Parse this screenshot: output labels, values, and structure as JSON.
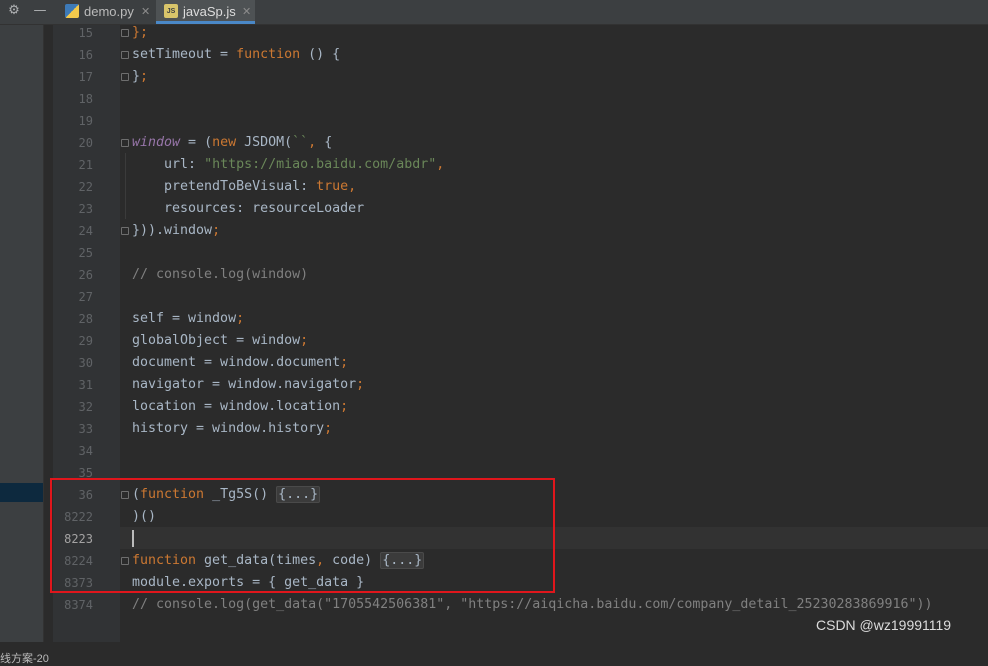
{
  "tabs": [
    {
      "label": "demo.py",
      "icon": "python-file-icon",
      "active": false
    },
    {
      "label": "javaSp.js",
      "icon": "js-file-icon",
      "active": true
    }
  ],
  "sidebar": {
    "cut_text": "线方案-20"
  },
  "current_line": "8223",
  "lines": [
    {
      "num": "15",
      "html": "<span class=\"kw\">}</span><span class=\"kw\">;</span>"
    },
    {
      "num": "16",
      "html": "setTimeout = <span class=\"kw\">function</span> () {"
    },
    {
      "num": "17",
      "html": "}<span class=\"kw\">;</span>"
    },
    {
      "num": "18",
      "html": ""
    },
    {
      "num": "19",
      "html": ""
    },
    {
      "num": "20",
      "html": "<span class=\"glob\">window</span> = (<span class=\"kw\">new</span> JSDOM(<span class=\"str\">``</span><span class=\"kw\">,</span> {"
    },
    {
      "num": "21",
      "html": "    url: <span class=\"str\">\"https://miao.baidu.com/abdr\"</span><span class=\"kw\">,</span>"
    },
    {
      "num": "22",
      "html": "    pretendToBeVisual: <span class=\"kw\">true,</span>"
    },
    {
      "num": "23",
      "html": "    resources: resourceLoader"
    },
    {
      "num": "24",
      "html": "})).window<span class=\"kw\">;</span>"
    },
    {
      "num": "25",
      "html": ""
    },
    {
      "num": "26",
      "html": "<span class=\"cmt\">// console.log(window)</span>"
    },
    {
      "num": "27",
      "html": ""
    },
    {
      "num": "28",
      "html": "self = window<span class=\"kw\">;</span>"
    },
    {
      "num": "29",
      "html": "globalObject = window<span class=\"kw\">;</span>"
    },
    {
      "num": "30",
      "html": "document = window.document<span class=\"kw\">;</span>"
    },
    {
      "num": "31",
      "html": "navigator = window.navigator<span class=\"kw\">;</span>"
    },
    {
      "num": "32",
      "html": "location = window.location<span class=\"kw\">;</span>"
    },
    {
      "num": "33",
      "html": "history = window.history<span class=\"kw\">;</span>"
    },
    {
      "num": "34",
      "html": ""
    },
    {
      "num": "35",
      "html": ""
    },
    {
      "num": "36",
      "html": "(<span class=\"kw\">function</span> _Tg5S() <span class=\"fold-chip\">{...}</span>"
    },
    {
      "num": "8222",
      "html": ")()"
    },
    {
      "num": "8223",
      "html": ""
    },
    {
      "num": "8224",
      "html": "<span class=\"kw\">function</span> get_data(times<span class=\"kw\">,</span> code) <span class=\"fold-chip\">{...}</span>"
    },
    {
      "num": "8373",
      "html": "module.exports = { get_data }"
    },
    {
      "num": "8374",
      "html": "<span class=\"cmt\">// console.log(get_data(\"1705542506381\", \"https://aiqicha.baidu.com/company_detail_25230283869916\"))</span>"
    }
  ],
  "folds": [
    "15",
    "16",
    "17",
    "20",
    "24",
    "36",
    "8224"
  ],
  "watermark": "CSDN @wz19991119",
  "colors": {
    "keyword": "#cc7832",
    "string": "#6a8759",
    "comment": "#808080",
    "global": "#9876aa",
    "highlight_box": "#e0161c"
  }
}
